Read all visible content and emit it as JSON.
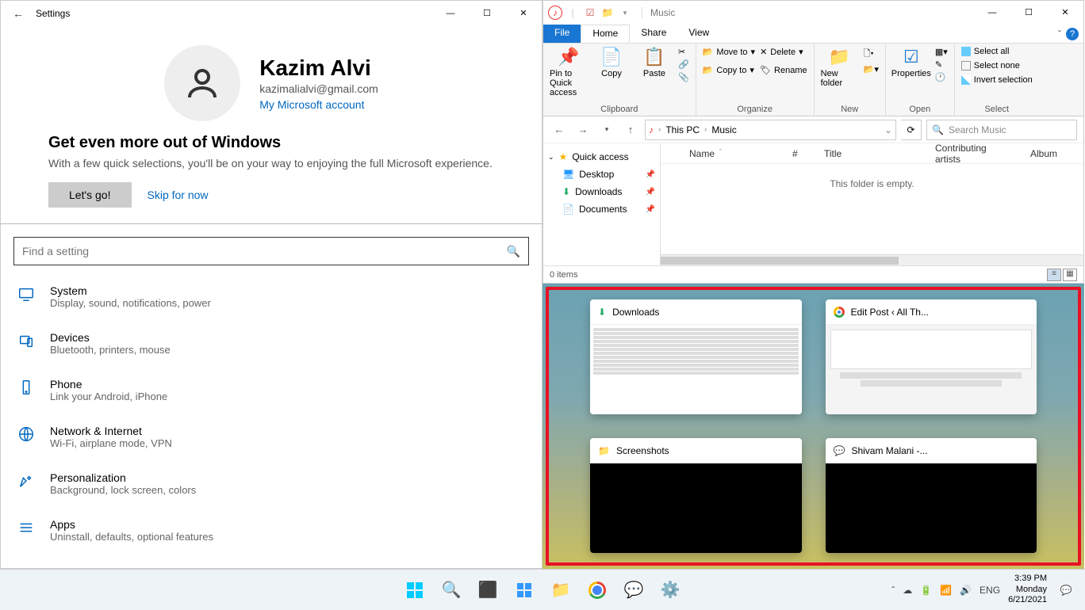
{
  "settings": {
    "title": "Settings",
    "profile": {
      "name": "Kazim Alvi",
      "email": "kazimalialvi@gmail.com",
      "ms_link": "My Microsoft account"
    },
    "promo": {
      "heading": "Get even more out of Windows",
      "sub": "With a few quick selections, you'll be on your way to enjoying the full Microsoft experience.",
      "cta": "Let's go!",
      "skip": "Skip for now"
    },
    "search_placeholder": "Find a setting",
    "cats": [
      {
        "title": "System",
        "sub": "Display, sound, notifications, power"
      },
      {
        "title": "Devices",
        "sub": "Bluetooth, printers, mouse"
      },
      {
        "title": "Phone",
        "sub": "Link your Android, iPhone"
      },
      {
        "title": "Network & Internet",
        "sub": "Wi-Fi, airplane mode, VPN"
      },
      {
        "title": "Personalization",
        "sub": "Background, lock screen, colors"
      },
      {
        "title": "Apps",
        "sub": "Uninstall, defaults, optional features"
      }
    ]
  },
  "explorer": {
    "title": "Music",
    "tabs": {
      "file": "File",
      "home": "Home",
      "share": "Share",
      "view": "View"
    },
    "ribbon": {
      "pin": "Pin to Quick access",
      "copy": "Copy",
      "paste": "Paste",
      "moveto": "Move to",
      "copyto": "Copy to",
      "delete": "Delete",
      "rename": "Rename",
      "newfolder": "New folder",
      "properties": "Properties",
      "open": "Open",
      "select_all": "Select all",
      "select_none": "Select none",
      "invert": "Invert selection",
      "g_clipboard": "Clipboard",
      "g_organize": "Organize",
      "g_new": "New",
      "g_open": "Open",
      "g_select": "Select"
    },
    "crumbs": {
      "pc": "This PC",
      "loc": "Music"
    },
    "search_placeholder": "Search Music",
    "nav": {
      "quick": "Quick access",
      "desktop": "Desktop",
      "downloads": "Downloads",
      "documents": "Documents"
    },
    "cols": {
      "name": "Name",
      "num": "#",
      "title": "Title",
      "ca": "Contributing artists",
      "album": "Album"
    },
    "empty": "This folder is empty.",
    "status": "0 items"
  },
  "snap": {
    "t1": "Downloads",
    "t2": "Edit Post ‹ All Th...",
    "t3": "Screenshots",
    "t4": "Shivam Malani -..."
  },
  "taskbar": {
    "lang": "ENG",
    "time": "3:39 PM",
    "day": "Monday",
    "date": "6/21/2021"
  }
}
